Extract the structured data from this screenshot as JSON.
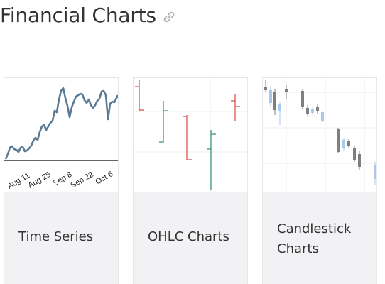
{
  "heading": {
    "title": "Financial Charts",
    "icon": "link-icon"
  },
  "cards": [
    {
      "label": "Time Series",
      "thumbnail": {
        "type": "line",
        "x_tick_labels": [
          "Aug 11",
          "Aug 25",
          "Sep 8",
          "Sep 22",
          "Oct 6"
        ],
        "line_color": "#5a7a95"
      }
    },
    {
      "label": "OHLC Charts",
      "thumbnail": {
        "type": "ohlc",
        "up_color": "#3d9970",
        "down_color": "#e05252"
      }
    },
    {
      "label": "Candlestick Charts",
      "thumbnail": {
        "type": "candlestick",
        "up_color": "#a8c8ec",
        "down_color": "#7f7f7f"
      }
    }
  ]
}
